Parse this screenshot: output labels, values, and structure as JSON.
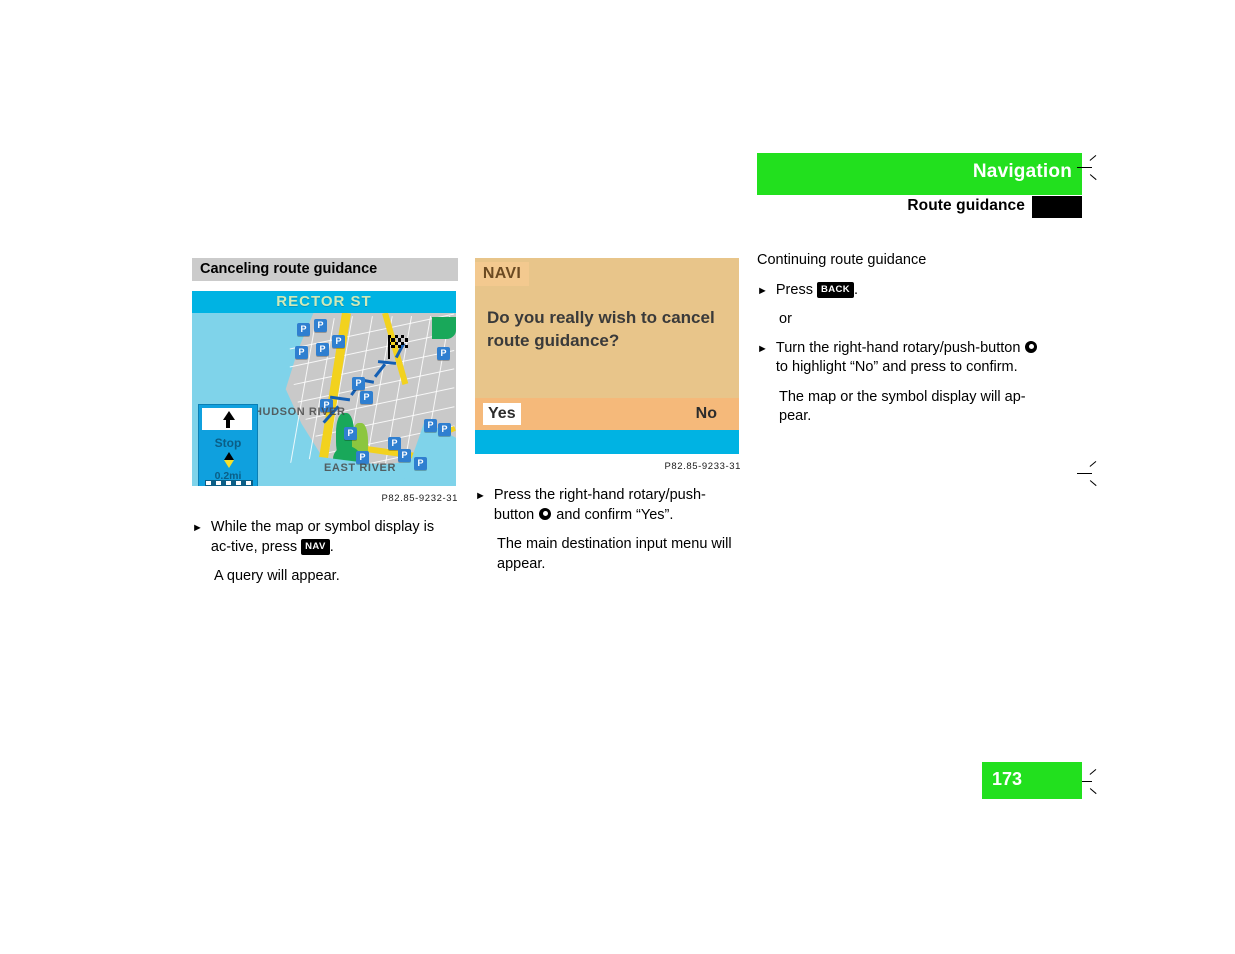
{
  "header": {
    "title": "Navigation",
    "subtitle": "Route guidance",
    "green": "#22e01e"
  },
  "page_number": "173",
  "columns": {
    "left": {
      "section_heading": "Canceling route guidance",
      "figure_caption": "P82.85-9232-31",
      "map": {
        "street_title": "RECTOR ST",
        "label_hudson": "HUDSON RIVER",
        "label_east": "EAST RIVER",
        "panel_status": "Stop",
        "panel_distance": "0.2mi",
        "parking_letter": "P"
      },
      "step1_text_a": "While the map or symbol display is ac-tive, press ",
      "step1_key": "NAV",
      "step1_text_b": ".",
      "step1_result": "A query will appear."
    },
    "middle": {
      "figure_caption": "P82.85-9233-31",
      "dialog": {
        "tag": "NAVI",
        "question": "Do you really wish to cancel route guidance?",
        "yes": "Yes",
        "no": "No"
      },
      "step1_text_a": "Press the right-hand rotary/push-button ",
      "step1_text_b": " and confirm “Yes”.",
      "step1_result": "The main destination input menu will appear."
    },
    "right": {
      "heading": "Continuing route guidance",
      "step1_text_a": "Press ",
      "step1_key": "BACK",
      "step1_text_b": ".",
      "or_label": "or",
      "step2_text_a": "Turn the right-hand rotary/push-button ",
      "step2_text_b": " to highlight “No” and press to confirm.",
      "step2_result": "The map or the symbol display will ap-pear."
    }
  }
}
